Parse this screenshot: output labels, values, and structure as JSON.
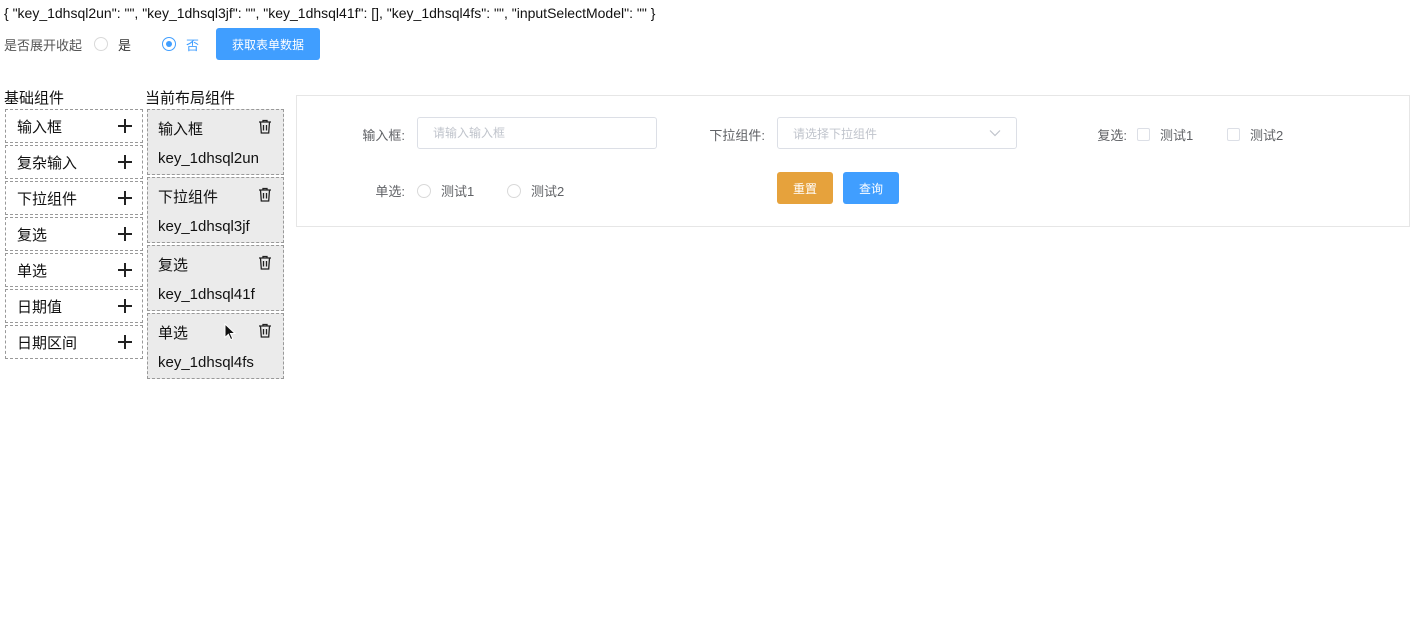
{
  "model_json": "{ \"key_1dhsql2un\": \"\", \"key_1dhsql3jf\": \"\", \"key_1dhsql41f\": [], \"key_1dhsql4fs\": \"\", \"inputSelectModel\": \"\" }",
  "toolbar": {
    "expand_label": "是否展开收起",
    "option_yes": "是",
    "option_no": "否",
    "selected": "否",
    "get_data_button": "获取表单数据"
  },
  "basic_panel": {
    "title": "基础组件",
    "items": [
      {
        "label": "输入框",
        "icon": "plus-icon"
      },
      {
        "label": "复杂输入",
        "icon": "plus-icon"
      },
      {
        "label": "下拉组件",
        "icon": "plus-icon"
      },
      {
        "label": "复选",
        "icon": "plus-icon"
      },
      {
        "label": "单选",
        "icon": "plus-icon"
      },
      {
        "label": "日期值",
        "icon": "plus-icon"
      },
      {
        "label": "日期区间",
        "icon": "plus-icon"
      }
    ]
  },
  "layout_panel": {
    "title": "当前布局组件",
    "items": [
      {
        "type": "输入框",
        "key": "key_1dhsql2un",
        "icon": "trash-icon"
      },
      {
        "type": "下拉组件",
        "key": "key_1dhsql3jf",
        "icon": "trash-icon"
      },
      {
        "type": "复选",
        "key": "key_1dhsql41f",
        "icon": "trash-icon"
      },
      {
        "type": "单选",
        "key": "key_1dhsql4fs",
        "icon": "trash-icon"
      }
    ]
  },
  "preview_form": {
    "input_label": "输入框:",
    "input_placeholder": "请输入输入框",
    "select_label": "下拉组件:",
    "select_placeholder": "请选择下拉组件",
    "checkbox_label": "复选:",
    "checkbox_options": [
      "测试1",
      "测试2"
    ],
    "radio_label": "单选:",
    "radio_options": [
      "测试1",
      "测试2"
    ],
    "reset_button": "重置",
    "query_button": "查询"
  },
  "colors": {
    "primary": "#409eff",
    "warning": "#e6a23c",
    "layout_item_bg": "#ebebeb"
  }
}
